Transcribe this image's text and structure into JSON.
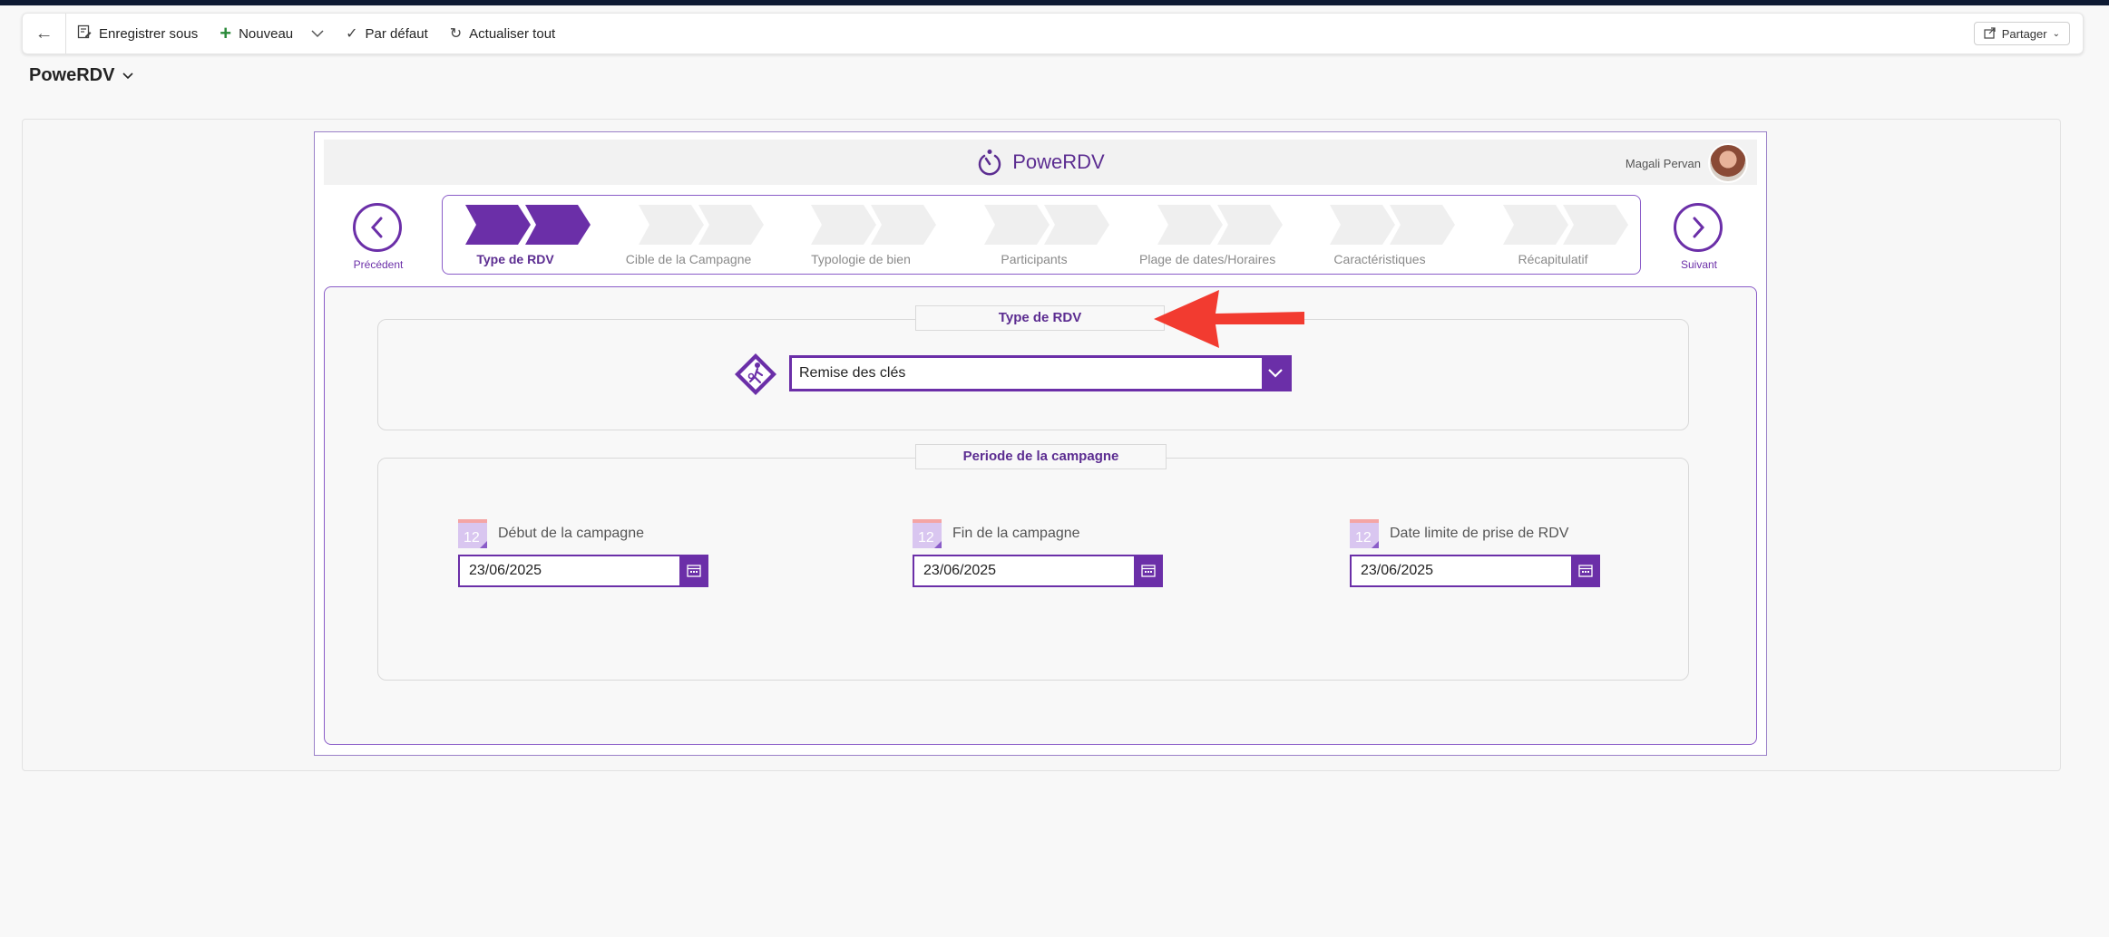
{
  "toolbar": {
    "save_as": "Enregistrer sous",
    "new": "Nouveau",
    "default": "Par défaut",
    "refresh_all": "Actualiser tout",
    "share": "Partager"
  },
  "app_title": "PoweRDV",
  "app": {
    "brand": "PoweRDV",
    "user_name": "Magali Pervan",
    "prev_label": "Précédent",
    "next_label": "Suivant",
    "steps": [
      {
        "label": "Type de RDV",
        "active": true
      },
      {
        "label": "Cible de la Campagne",
        "active": false
      },
      {
        "label": "Typologie de bien",
        "active": false
      },
      {
        "label": "Participants",
        "active": false
      },
      {
        "label": "Plage de dates/Horaires",
        "active": false
      },
      {
        "label": "Caractéristiques",
        "active": false
      },
      {
        "label": "Récapitulatif",
        "active": false
      }
    ],
    "type_section_title": "Type de RDV",
    "type_value": "Remise des clés",
    "period_section_title": "Periode de la campagne",
    "start_label": "Début de la campagne",
    "start_value": "23/06/2025",
    "end_label": "Fin de la campagne",
    "end_value": "23/06/2025",
    "deadline_label": "Date limite de prise de RDV",
    "deadline_value": "23/06/2025",
    "calendar_glyph": "12"
  },
  "colors": {
    "accent": "#6b2fa8",
    "inactive_step": "#efefef",
    "annotation_arrow": "#f23b30"
  }
}
